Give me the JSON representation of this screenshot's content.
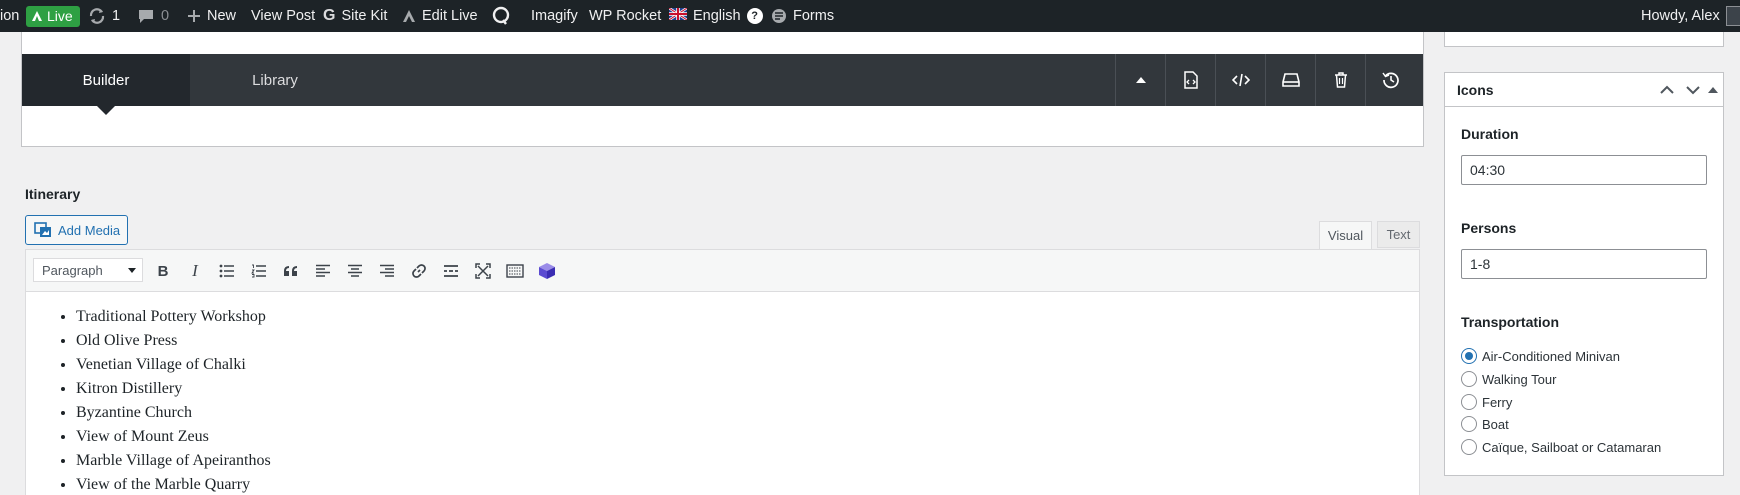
{
  "admin_bar": {
    "site_fragment": "ion",
    "live": "Live",
    "updates_count": "1",
    "comments_count": "0",
    "new": "New",
    "view_post": "View Post",
    "site_kit": "Site Kit",
    "edit_live": "Edit Live",
    "imagify": "Imagify",
    "wp_rocket": "WP Rocket",
    "language": "English",
    "help": "?",
    "forms": "Forms",
    "howdy": "Howdy, Alex",
    "colors": {
      "bar": "#1d2327",
      "live_bg": "#2ea043"
    }
  },
  "builder": {
    "tabs": [
      "Builder",
      "Library"
    ],
    "active_tab": "Builder",
    "tool_icons": [
      "caret-up-icon",
      "file-code-icon",
      "code-icon",
      "save-layout-icon",
      "trash-icon",
      "history-icon"
    ]
  },
  "itinerary": {
    "label": "Itinerary",
    "add_media": "Add Media",
    "tabs": {
      "visual": "Visual",
      "text": "Text"
    },
    "format_select": "Paragraph",
    "toolbar_icons": [
      "bold-icon",
      "italic-icon",
      "bullet-list-icon",
      "numbered-list-icon",
      "blockquote-icon",
      "align-left-icon",
      "align-center-icon",
      "align-right-icon",
      "link-icon",
      "read-more-icon",
      "fullscreen-icon",
      "toolbar-toggle-icon",
      "plugin-cube-icon"
    ],
    "items": [
      "Traditional Pottery Workshop",
      "Old Olive Press",
      "Venetian Village of Chalki",
      "Kitron Distillery",
      "Byzantine Church",
      "View of Mount Zeus",
      "Marble Village of Apeiranthos",
      "View of the Marble Quarry"
    ]
  },
  "sidebar": {
    "box_title": "Icons",
    "duration": {
      "label": "Duration",
      "value": "04:30"
    },
    "persons": {
      "label": "Persons",
      "value": "1-8"
    },
    "transportation": {
      "label": "Transportation",
      "selected": "Air-Conditioned Minivan",
      "options": [
        "Air-Conditioned Minivan",
        "Walking Tour",
        "Ferry",
        "Boat",
        "Caïque, Sailboat or Catamaran"
      ]
    },
    "accent": "#2271b1"
  }
}
